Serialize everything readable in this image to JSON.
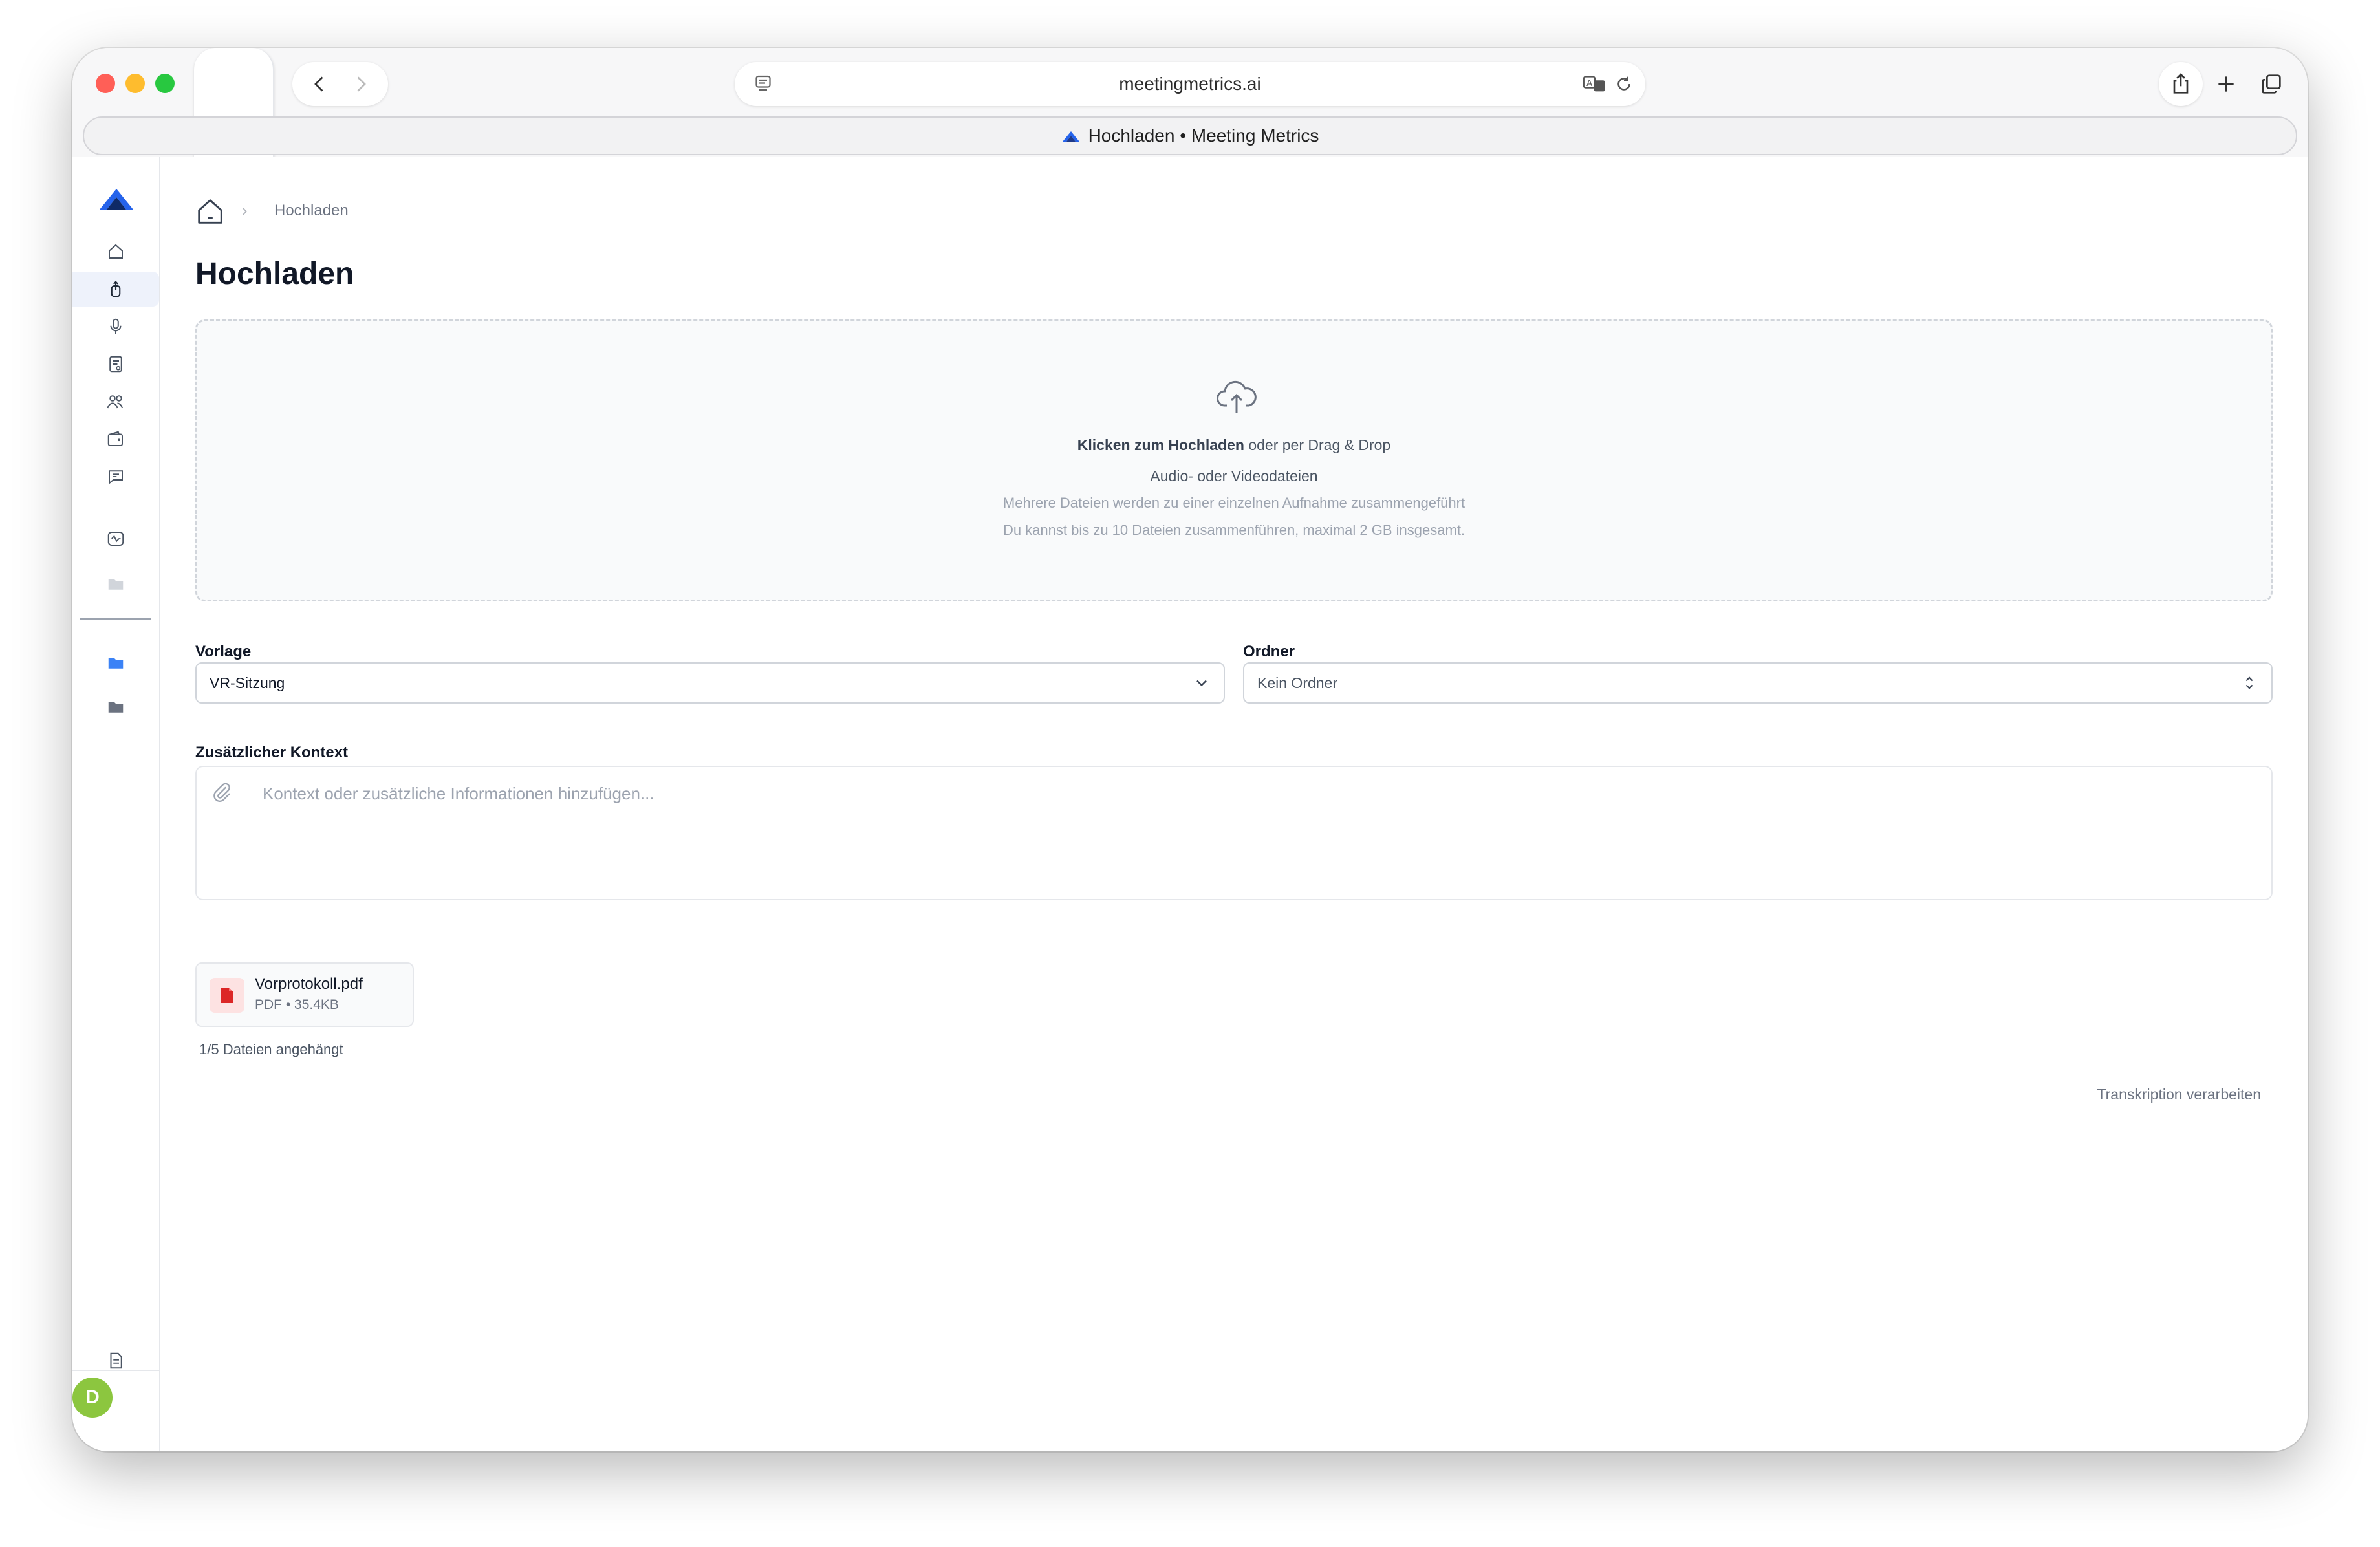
{
  "browser": {
    "url": "meetingmetrics.ai",
    "tab_title": "Hochladen • Meeting Metrics"
  },
  "sidebar": {
    "items": [
      {
        "icon": "home-icon"
      },
      {
        "icon": "upload-icon",
        "active": true
      },
      {
        "icon": "microphone-icon"
      },
      {
        "icon": "templates-icon"
      },
      {
        "icon": "team-icon"
      },
      {
        "icon": "wallet-icon"
      },
      {
        "icon": "chat-icon"
      },
      {
        "icon": "integration-icon"
      },
      {
        "icon": "folder-icon"
      },
      {
        "icon": "folder-blue-icon"
      },
      {
        "icon": "folder-gray-icon"
      },
      {
        "icon": "document-icon"
      }
    ],
    "avatar_initial": "D",
    "avatar_color": "#8cc63f"
  },
  "breadcrumb": {
    "current": "Hochladen"
  },
  "page": {
    "title": "Hochladen"
  },
  "dropzone": {
    "click_label": "Klicken zum Hochladen",
    "drag_label": " oder per Drag & Drop",
    "types": "Audio- oder Videodateien",
    "merge_hint": "Mehrere Dateien werden zu einer einzelnen Aufnahme zusammengeführt",
    "limit_hint": "Du kannst bis zu 10 Dateien zusammenführen, maximal 2 GB insgesamt."
  },
  "template_field": {
    "label": "Vorlage",
    "value": "VR-Sitzung"
  },
  "folder_field": {
    "label": "Ordner",
    "value": "Kein Ordner"
  },
  "context_field": {
    "label": "Zusätzlicher Kontext",
    "placeholder": "Kontext oder zusätzliche Informationen hinzufügen..."
  },
  "attachment": {
    "name": "Vorprotokoll.pdf",
    "meta": "PDF • 35.4KB",
    "count_text": "1/5 Dateien angehängt"
  },
  "actions": {
    "process_label": "Transkription verarbeiten"
  },
  "colors": {
    "brand_blue": "#2563eb",
    "chat_button": "#4f1cf2",
    "pdf_red": "#dc2626"
  }
}
